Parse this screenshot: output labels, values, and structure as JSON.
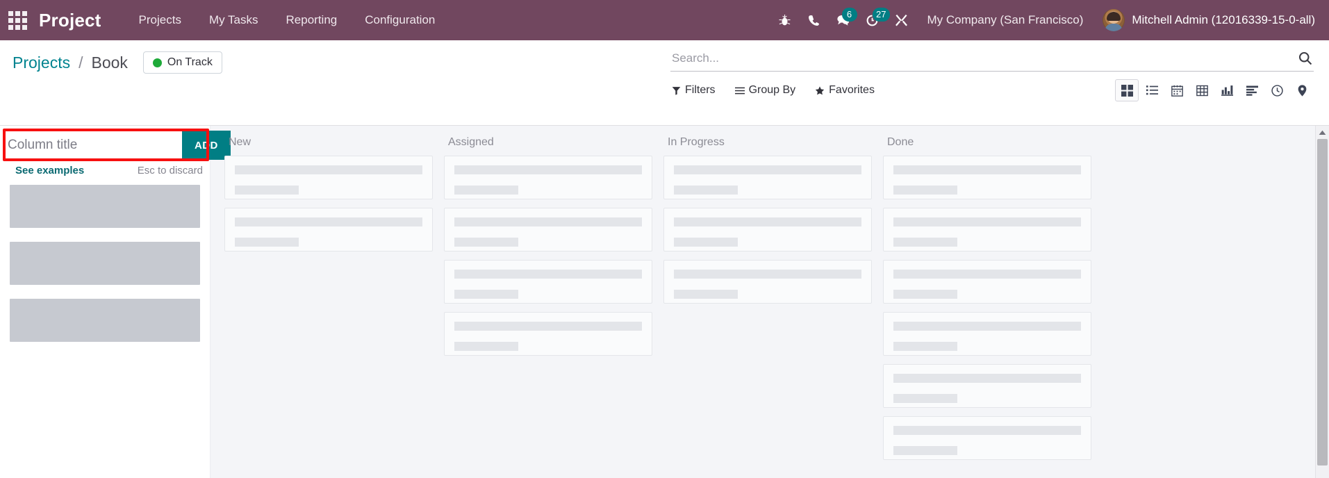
{
  "navbar": {
    "apps_icon": "apps-grid-icon",
    "brand": "Project",
    "menu": [
      {
        "label": "Projects"
      },
      {
        "label": "My Tasks"
      },
      {
        "label": "Reporting"
      },
      {
        "label": "Configuration"
      }
    ],
    "icons": [
      {
        "name": "bug-icon",
        "badge": null
      },
      {
        "name": "phone-icon",
        "badge": null
      },
      {
        "name": "messages-icon",
        "badge": "6"
      },
      {
        "name": "activities-clock-icon",
        "badge": "27"
      },
      {
        "name": "tools-icon",
        "badge": null
      }
    ],
    "company": "My Company (San Francisco)",
    "user": "Mitchell Admin (12016339-15-0-all)",
    "accent": "#71475f",
    "badge_color": "#017e84"
  },
  "control_panel": {
    "breadcrumb": {
      "root": "Projects",
      "separator": "/",
      "current": "Book"
    },
    "status_badge": {
      "label": "On Track",
      "dot_color": "#1eaa39"
    },
    "search": {
      "placeholder": "Search...",
      "value": "",
      "search_icon": "search-icon"
    },
    "filters": [
      {
        "label": "Filters",
        "icon": "funnel-icon"
      },
      {
        "label": "Group By",
        "icon": "bars-icon"
      },
      {
        "label": "Favorites",
        "icon": "star-icon"
      }
    ],
    "views": [
      {
        "name": "kanban-view",
        "icon": "kanban-icon",
        "active": true
      },
      {
        "name": "list-view",
        "icon": "list-icon",
        "active": false
      },
      {
        "name": "calendar-view",
        "icon": "calendar-icon",
        "active": false
      },
      {
        "name": "pivot-view",
        "icon": "table-icon",
        "active": false
      },
      {
        "name": "graph-view",
        "icon": "bar-chart-icon",
        "active": false
      },
      {
        "name": "gantt-view",
        "icon": "gantt-icon",
        "active": false
      },
      {
        "name": "activity-view",
        "icon": "clock-icon",
        "active": false
      },
      {
        "name": "map-view",
        "icon": "map-pin-icon",
        "active": false
      }
    ]
  },
  "add_column": {
    "input_placeholder": "Column title",
    "input_value": "",
    "add_label": "ADD",
    "see_examples": "See examples",
    "esc_hint": "Esc to discard",
    "ghost_blocks": 3,
    "highlight_color": "#f71010",
    "add_button_color": "#017e84"
  },
  "kanban": {
    "columns": [
      {
        "title": "New",
        "cards": 2
      },
      {
        "title": "Assigned",
        "cards": 4
      },
      {
        "title": "In Progress",
        "cards": 3
      },
      {
        "title": "Done",
        "cards": 6
      }
    ]
  }
}
